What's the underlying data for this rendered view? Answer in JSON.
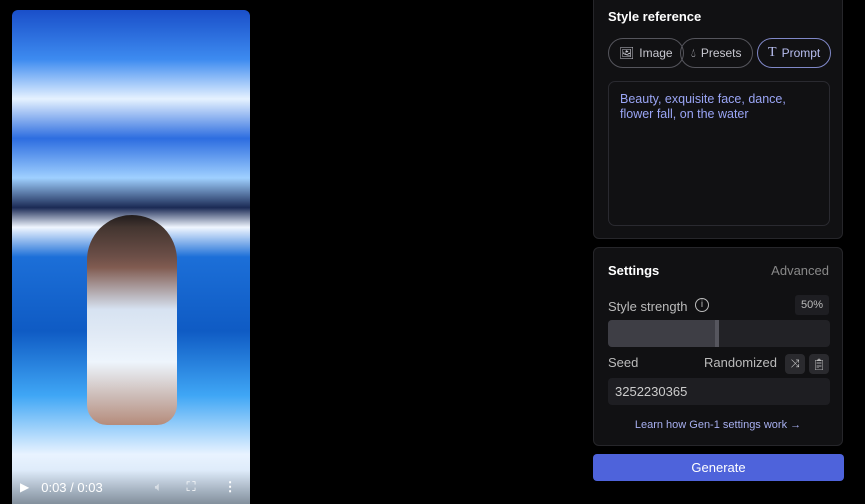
{
  "video": {
    "time": "0:03 / 0:03",
    "progress": 1.0
  },
  "style_reference": {
    "title": "Style reference",
    "tabs": [
      {
        "label": "Image",
        "icon": "image-icon"
      },
      {
        "label": "Presets",
        "icon": "drop-icon"
      },
      {
        "label": "Prompt",
        "icon": "text-icon",
        "active": true
      }
    ],
    "prompt": "Beauty, exquisite face, dance, flower fall, on the water"
  },
  "settings": {
    "title": "Settings",
    "advanced": "Advanced",
    "style_strength_label": "Style strength",
    "style_strength_value": "50%",
    "style_strength": 0.5,
    "seed_label": "Seed",
    "randomized": "Randomized",
    "seed": "3252230365",
    "learn": "Learn how Gen-1 settings work →"
  },
  "generate": "Generate",
  "colors": {
    "accent": "#4e63db",
    "prompt_text": "#9aa5f5"
  }
}
